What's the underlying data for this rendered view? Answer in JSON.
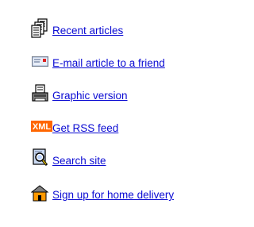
{
  "tools": {
    "items": [
      {
        "label": "Recent articles",
        "icon": "documents-icon"
      },
      {
        "label": "E-mail article to a friend",
        "icon": "email-card-icon"
      },
      {
        "label": "Graphic version",
        "icon": "printer-icon"
      },
      {
        "label": "Get RSS feed",
        "icon": "xml-feed-icon",
        "badge": "XML"
      },
      {
        "label": "Search site",
        "icon": "search-document-icon"
      },
      {
        "label": "Sign up for home delivery",
        "icon": "house-icon"
      }
    ]
  },
  "colors": {
    "link": "#0b0bd3",
    "xml_badge": "#ff6600"
  }
}
